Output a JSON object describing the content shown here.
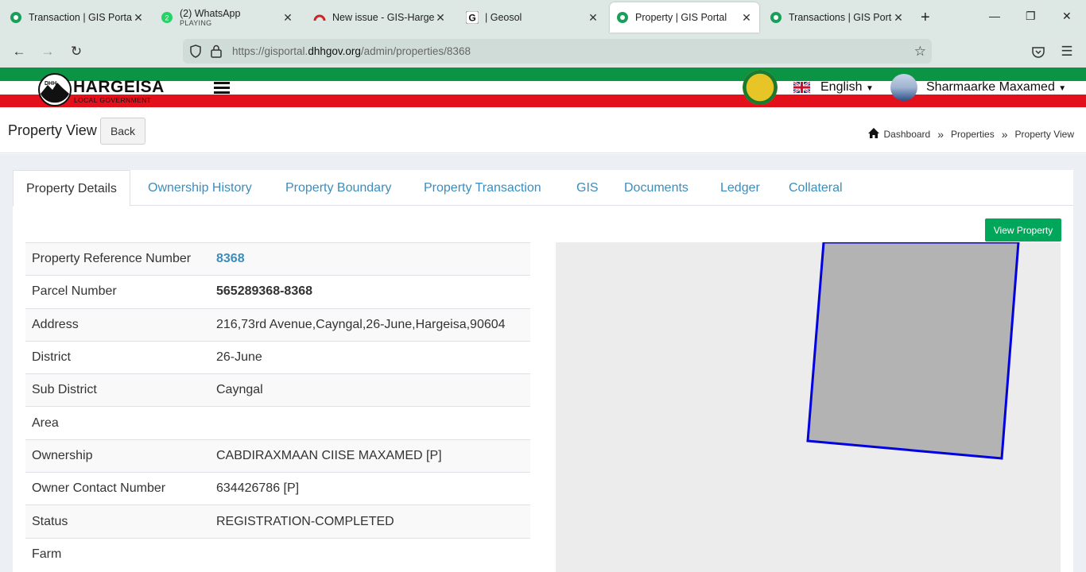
{
  "browser": {
    "tabs": [
      {
        "title": "Transaction | GIS Portal",
        "favicon": "gis-portal-icon"
      },
      {
        "title": "(2) WhatsApp",
        "subtitle": "PLAYING",
        "favicon": "whatsapp-icon"
      },
      {
        "title": "New issue - GIS-Hargesia",
        "favicon": "gitlab-icon"
      },
      {
        "title": "| Geosol",
        "favicon": "google-icon"
      },
      {
        "title": "Property | GIS Portal",
        "favicon": "gis-portal-icon",
        "active": true
      },
      {
        "title": "Transactions | GIS Portal",
        "favicon": "gis-portal-icon"
      }
    ],
    "url_prefix": "https://gisportal.",
    "url_domain": "dhhgov.org",
    "url_path": "/admin/properties/8368"
  },
  "header": {
    "logo_text": "HARGEISA",
    "logo_sub": "LOCAL GOVERNMENT",
    "logo_mark": "DHH",
    "language": "English",
    "user": "Sharmaarke Maxamed"
  },
  "content_header": {
    "title": "Property View",
    "back_label": "Back",
    "breadcrumb": [
      "Dashboard",
      "Properties",
      "Property View"
    ]
  },
  "tabs": [
    "Property Details",
    "Ownership History",
    "Property Boundary",
    "Property Transaction",
    "GIS",
    "Documents",
    "Ledger",
    "Collateral"
  ],
  "view_property_label": "View Property",
  "details": [
    {
      "label": "Property Reference Number",
      "value": "8368"
    },
    {
      "label": "Parcel Number",
      "value": "565289368-8368"
    },
    {
      "label": "Address",
      "value": "216,73rd Avenue,Cayngal,26-June,Hargeisa,90604"
    },
    {
      "label": "District",
      "value": "26-June"
    },
    {
      "label": "Sub District",
      "value": "Cayngal"
    },
    {
      "label": "Area",
      "value": ""
    },
    {
      "label": "Ownership",
      "value": "CABDIRAXMAAN CIISE MAXAMED [P]"
    },
    {
      "label": "Owner Contact Number",
      "value": "634426786 [P]"
    },
    {
      "label": "Status",
      "value": "REGISTRATION-COMPLETED"
    },
    {
      "label": "Farm",
      "value": ""
    }
  ],
  "colors": {
    "accent": "#3c8dbc",
    "success": "#00a65a",
    "flag_green": "#0b9444",
    "flag_red": "#e3101b",
    "parcel_fill": "#b3b3b3",
    "parcel_stroke": "#0000e0"
  }
}
